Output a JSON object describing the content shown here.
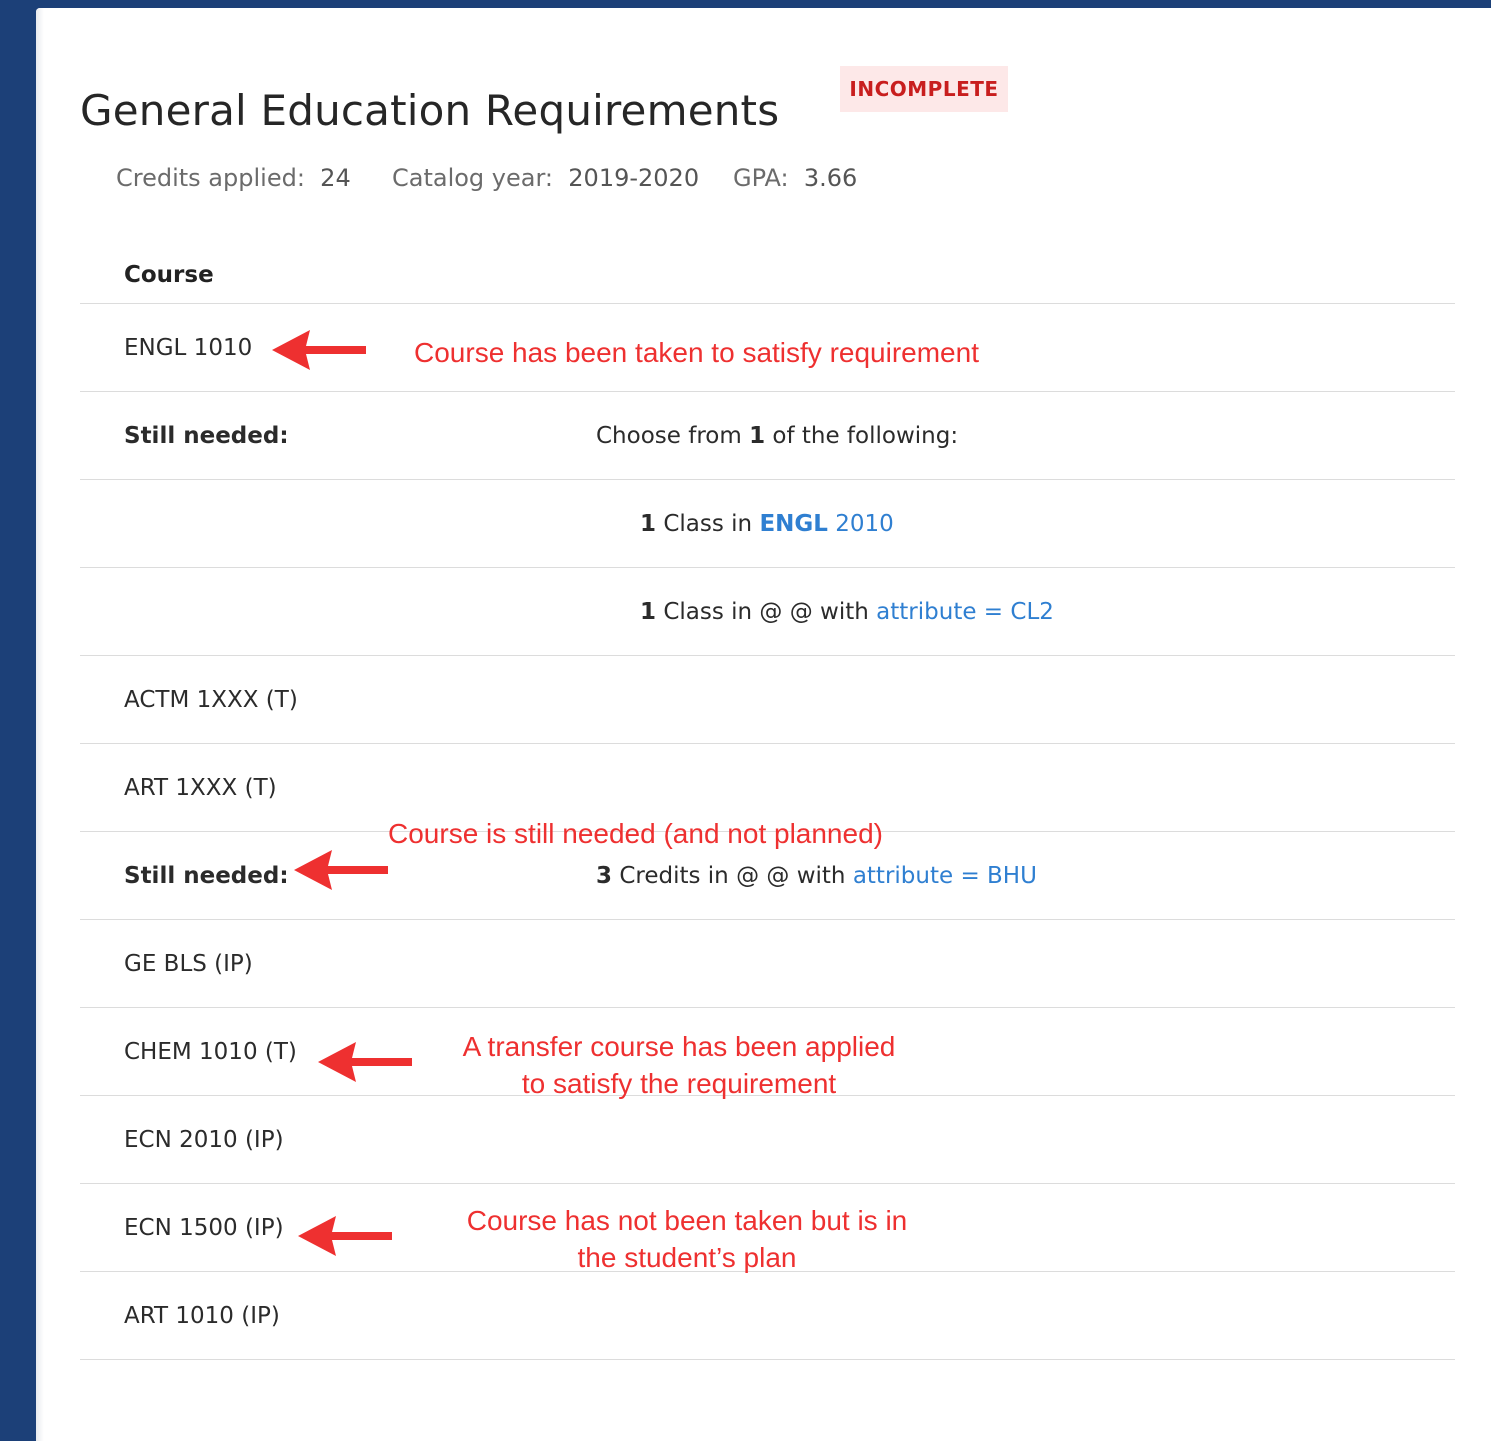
{
  "colors": {
    "page_background": "#1c4078",
    "badge_background": "#fde8e8",
    "badge_text": "#c81e1e",
    "link": "#2f7fd1",
    "annotation": "#ee3030"
  },
  "header": {
    "title": "General Education Requirements",
    "status_badge": "INCOMPLETE"
  },
  "meta": {
    "credits_label": "Credits applied:",
    "credits_value": "24",
    "catalog_label": "Catalog year:",
    "catalog_value": "2019-2020",
    "gpa_label": "GPA:",
    "gpa_value": "3.66"
  },
  "table": {
    "column_header": "Course",
    "rows": {
      "engl1010": "ENGL 1010",
      "still_needed_1": "Still needed:",
      "choose_prefix": "Choose from",
      "choose_count": "1",
      "choose_suffix": "of the following:",
      "opt1_count": "1",
      "opt1_text": "Class in",
      "opt1_subject": "ENGL",
      "opt1_number": "2010",
      "opt2_count": "1",
      "opt2_text": "Class in @ @ with",
      "opt2_attr": "attribute = CL2",
      "actm": "ACTM 1XXX (T)",
      "art1xxx": "ART 1XXX (T)",
      "still_needed_2": "Still needed:",
      "bhu_count": "3",
      "bhu_text": "Credits in @ @ with",
      "bhu_attr": "attribute = BHU",
      "gebls": "GE BLS (IP)",
      "chem": "CHEM 1010 (T)",
      "ecn2010": "ECN 2010 (IP)",
      "ecn1500": "ECN 1500 (IP)",
      "art1010": "ART 1010 (IP)"
    }
  },
  "annotations": {
    "taken": "Course has been taken to satisfy requirement",
    "still_needed": "Course is still needed (and not planned)",
    "transfer_line1": "A transfer course has been applied",
    "transfer_line2": "to satisfy the requirement",
    "planned_line1": "Course has not been taken but is in",
    "planned_line2": "the student’s plan"
  }
}
